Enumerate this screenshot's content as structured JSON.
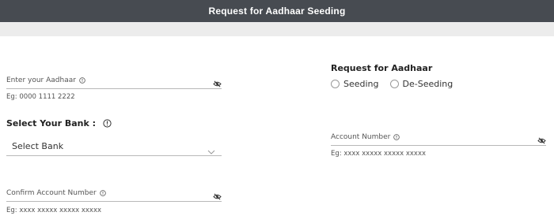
{
  "header": {
    "title": "Request for Aadhaar Seeding"
  },
  "aadhaar": {
    "placeholder": "Enter your Aadhaar",
    "hint": "Eg: 0000 1111 2222"
  },
  "bank": {
    "label": "Select Your Bank :",
    "selected": "Select Bank"
  },
  "confirm_account": {
    "placeholder": "Confirm Account Number",
    "hint": "Eg: xxxx xxxxx xxxxx xxxxx"
  },
  "request": {
    "title": "Request for Aadhaar",
    "options": [
      {
        "label": "Seeding"
      },
      {
        "label": "De-Seeding"
      }
    ]
  },
  "account": {
    "placeholder": "Account Number",
    "hint": "Eg: xxxx xxxxx xxxxx xxxxx"
  },
  "icons": {
    "info": "info-icon",
    "eye": "eye-slash-icon",
    "chevron": "chevron-down-icon"
  }
}
